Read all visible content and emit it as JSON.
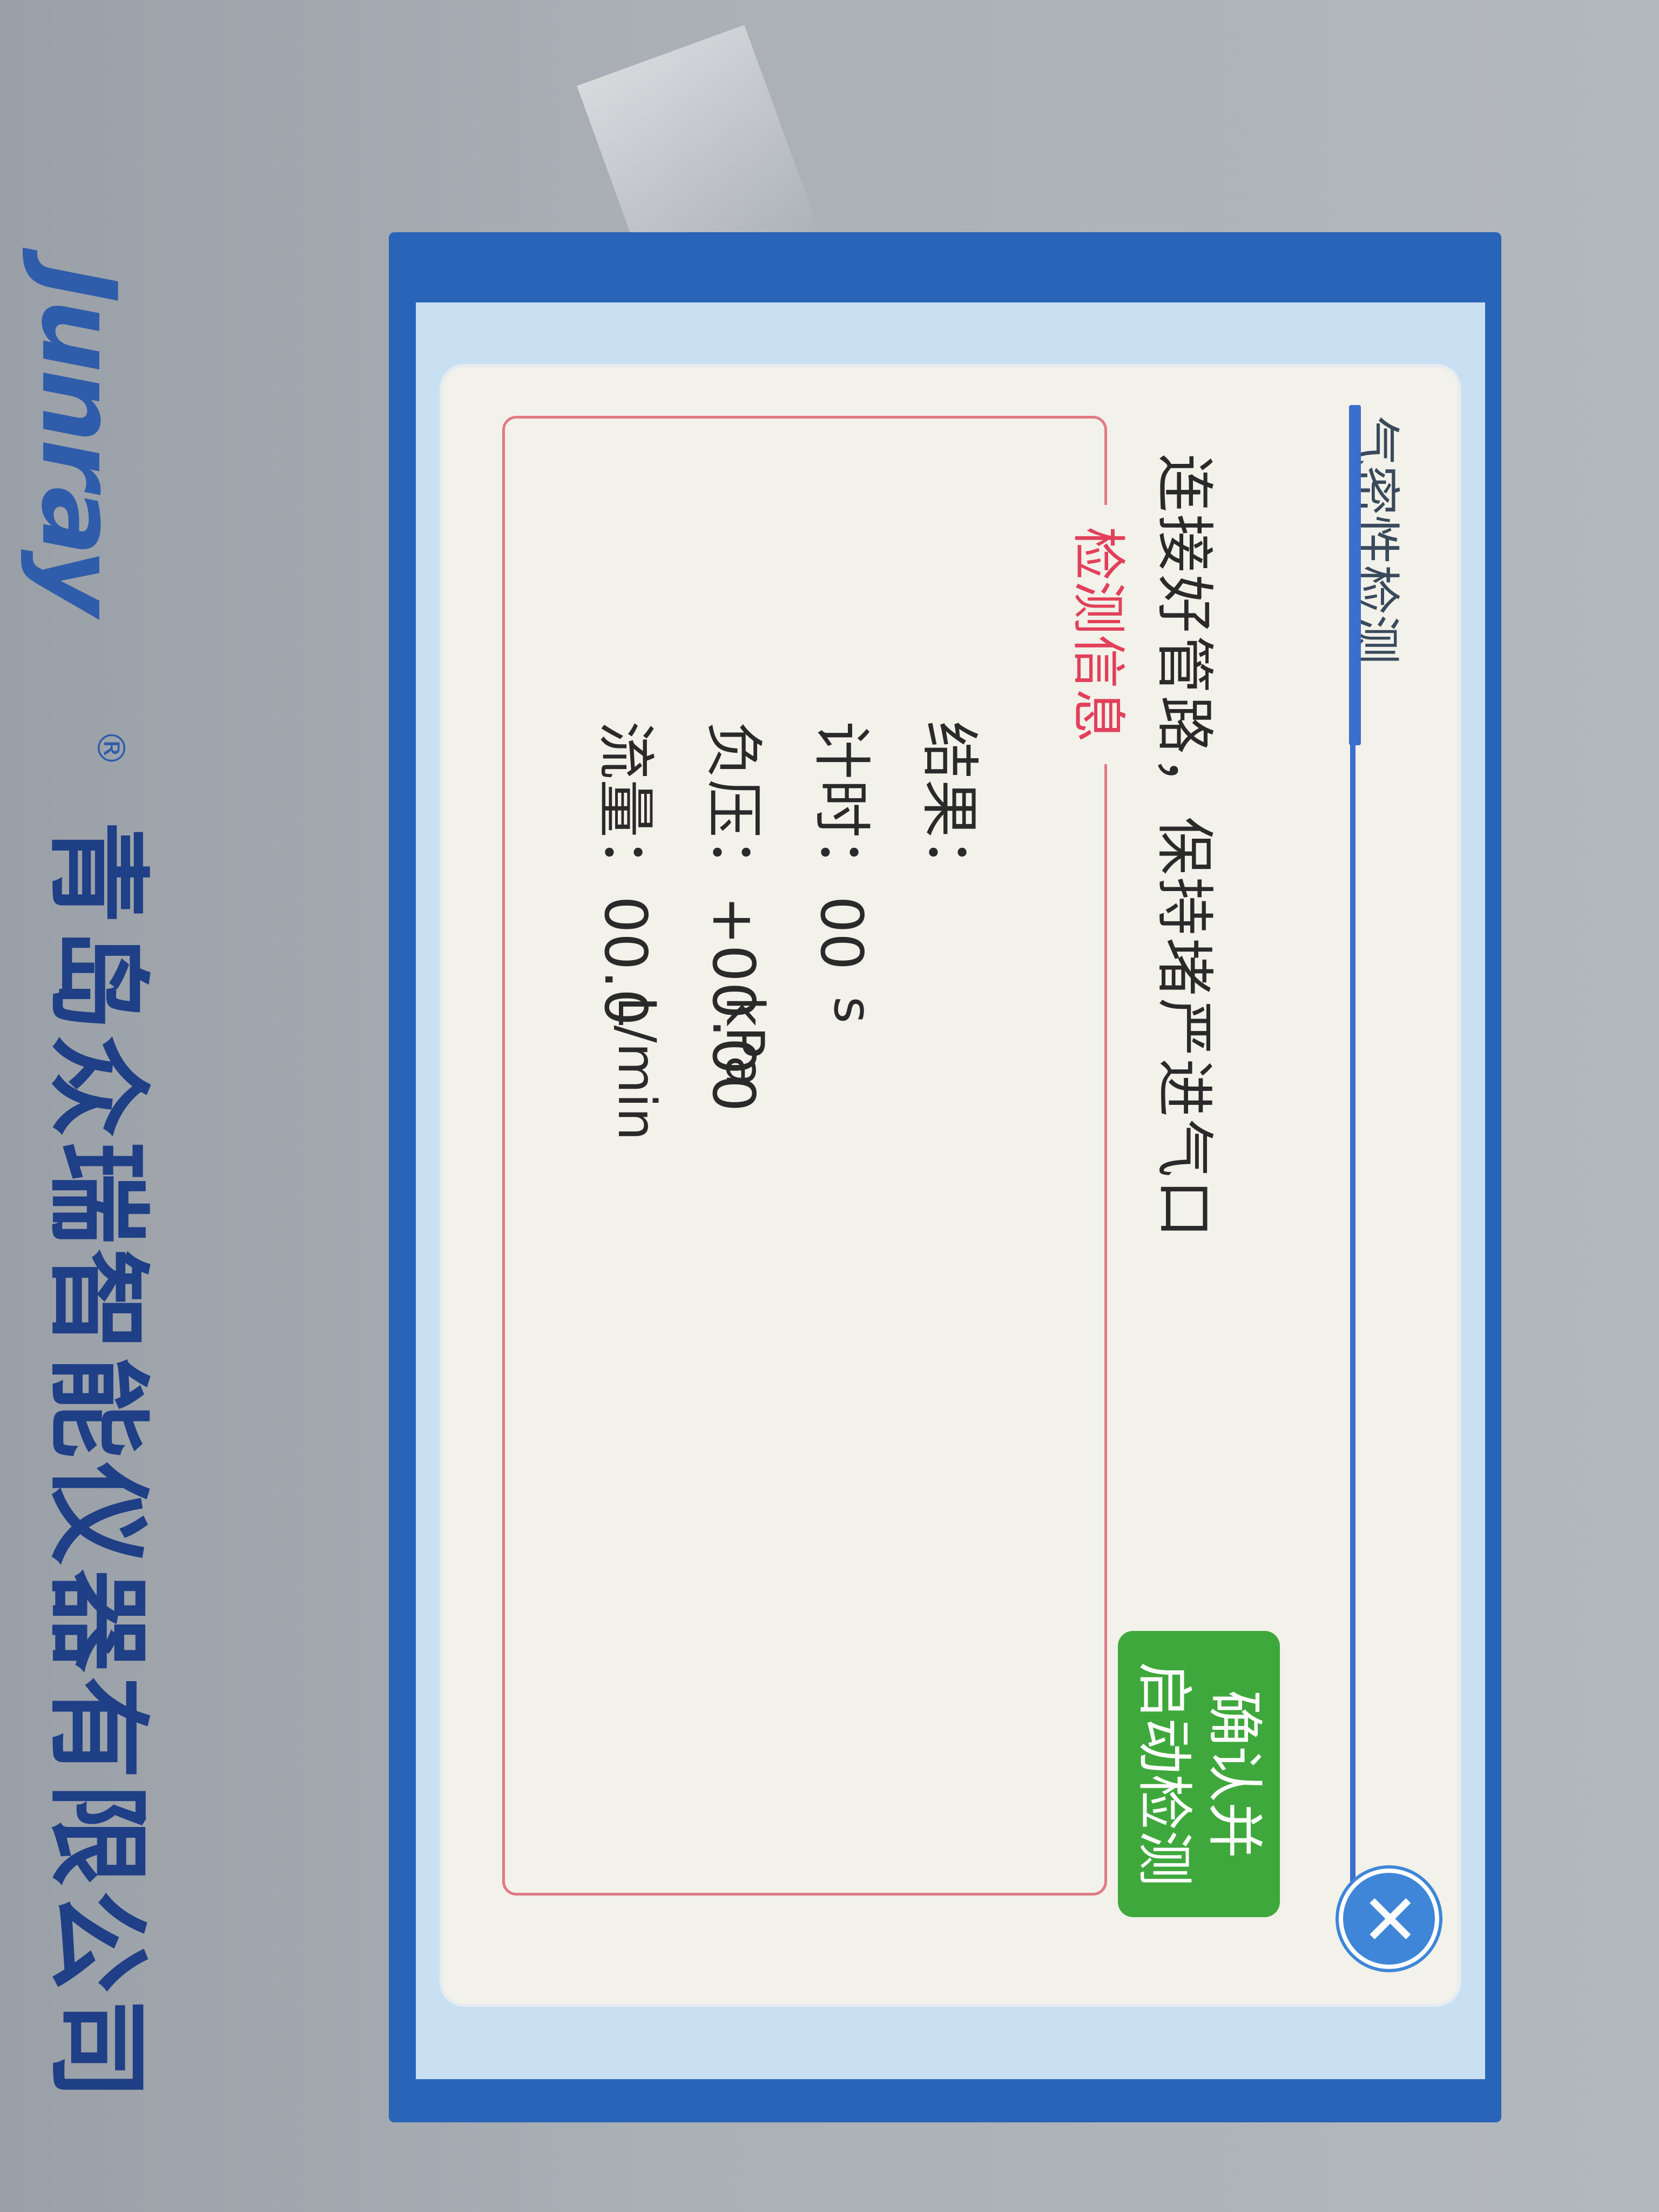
{
  "brand": {
    "logo_text": "Junray",
    "registered_mark": "®",
    "company_name": "青岛众瑞智能仪器有限公司"
  },
  "dialog": {
    "title": "气密性检测",
    "instruction": "连接好管路，保持堵严进气口",
    "confirm_button_label_line1": "确认并",
    "confirm_button_label_line2": "启动检测",
    "close_icon": "close-icon"
  },
  "info": {
    "legend": "检测信息",
    "result_label": "结果：",
    "result_value": "",
    "timer_label": "计时：",
    "timer_value": "00",
    "timer_unit": "s",
    "pressure_label": "负压：",
    "pressure_value": "+00.00",
    "pressure_unit": "kPa",
    "flow_label": "流量：",
    "flow_value": "00.0",
    "flow_unit": "L/min"
  },
  "colors": {
    "frame_blue": "#2a64b8",
    "accent_blue": "#3a6fcb",
    "button_green": "#3fa83c",
    "legend_red": "#e2405a",
    "dialog_bg": "#f2f1ea"
  }
}
